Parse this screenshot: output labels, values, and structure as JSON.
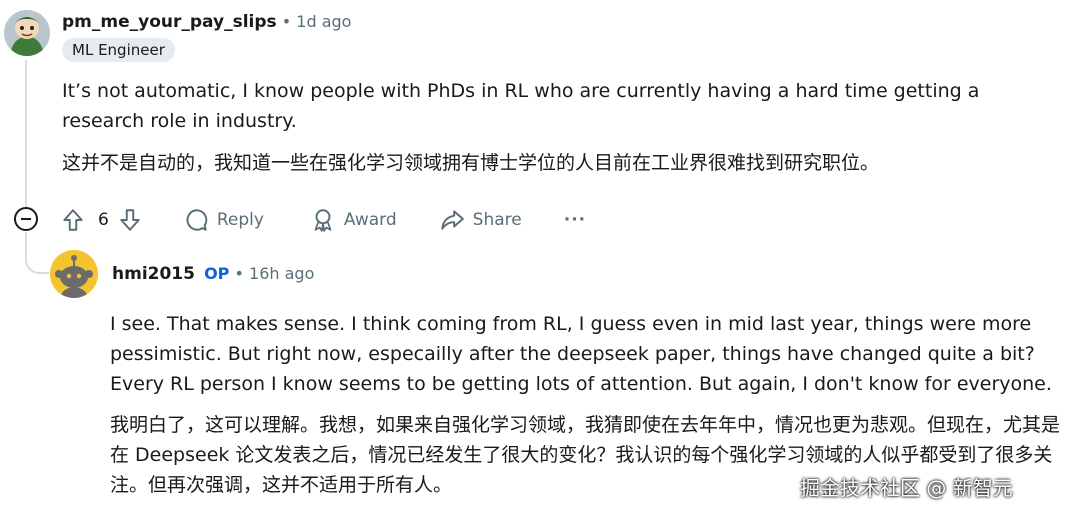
{
  "comment1": {
    "author": "pm_me_your_pay_slips",
    "time": "1d ago",
    "flair": "ML Engineer",
    "text_en": "It’s not automatic, I know people with PhDs in RL who are currently having a hard time getting a research role in industry.",
    "text_zh": "这并不是自动的，我知道一些在强化学习领域拥有博士学位的人目前在工业界很难找到研究职位。",
    "actions": {
      "votes": "6",
      "reply": "Reply",
      "award": "Award",
      "share": "Share",
      "more": "···"
    }
  },
  "comment2": {
    "author": "hmi2015",
    "op_label": "OP",
    "time": "16h ago",
    "text_en": "I see. That makes sense. I think coming from RL, I guess even in mid last year, things were more pessimistic. But right now, especailly after the deepseek paper, things have changed quite a bit? Every RL person I know seems to be getting lots of attention. But again, I don't know for everyone.",
    "text_zh": "我明白了，这可以理解。我想，如果来自强化学习领域，我猜即使在去年年中，情况也更为悲观。但现在，尤其是在 Deepseek 论文发表之后，情况已经发生了很大的变化？我认识的每个强化学习领域的人似乎都受到了很多关注。但再次强调，这并不适用于所有人。"
  },
  "watermark": {
    "text": "掘金技术社区 @ 新智元"
  },
  "colors": {
    "meta": "#576f76",
    "op": "#0a66d6",
    "flair_bg": "#e5ebee",
    "thread_line": "#d6dde0"
  }
}
